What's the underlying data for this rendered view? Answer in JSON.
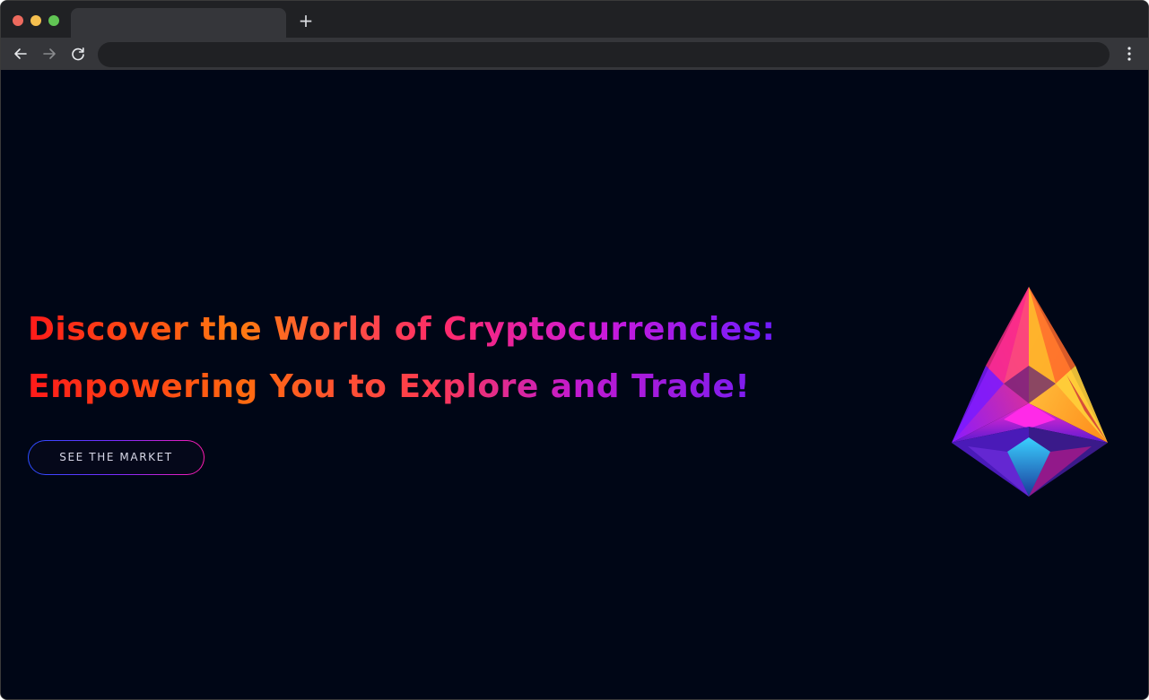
{
  "browser": {
    "url": "",
    "new_tab_label": "+"
  },
  "hero": {
    "title_line1": "Discover the World of Cryptocurrencies:",
    "title_line2": "Empowering You to Explore and Trade!",
    "cta_label": "SEE THE MARKET"
  },
  "colors": {
    "page_background": "#000616",
    "gradient_start": "#ff1a1a",
    "gradient_mid": "#ff7a10",
    "gradient_pink": "#ff2a6a",
    "gradient_end": "#6a1cff",
    "button_border_start": "#2a4cff",
    "button_border_end": "#ff1ab0"
  },
  "icons": {
    "back": "arrow-left-icon",
    "forward": "arrow-right-icon",
    "reload": "reload-icon",
    "menu": "kebab-menu-icon",
    "hero_image": "ethereum-crystal-logo"
  }
}
